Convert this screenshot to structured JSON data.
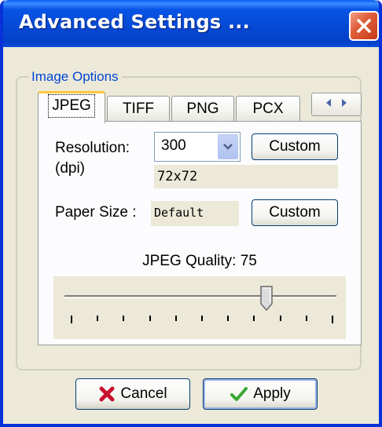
{
  "window": {
    "title": "Advanced Settings ..."
  },
  "group": {
    "legend": "Image Options"
  },
  "tabs": [
    {
      "label": "JPEG",
      "active": true
    },
    {
      "label": "TIFF",
      "active": false
    },
    {
      "label": "PNG",
      "active": false
    },
    {
      "label": "PCX",
      "active": false
    }
  ],
  "scroll": {
    "left_icon": "arrow-left-icon",
    "right_icon": "arrow-right-icon"
  },
  "resolution": {
    "label_line1": "Resolution:",
    "label_line2": "(dpi)",
    "selected": "300",
    "custom_label": "Custom",
    "readout": "72x72"
  },
  "paper": {
    "label": "Paper Size :",
    "value": "Default",
    "custom_label": "Custom"
  },
  "quality": {
    "label": "JPEG Quality:",
    "value": "75",
    "slider_fraction": 0.75,
    "tick_count": 11
  },
  "footer": {
    "cancel_label": "Cancel",
    "cancel_icon": "red-x-icon",
    "apply_label": "Apply",
    "apply_icon": "green-check-icon"
  },
  "colors": {
    "titlebar": "#0854e6",
    "legend": "#0046d5",
    "close": "#e0603a",
    "active_tab_accent": "#ffc83c",
    "cancel_icon": "#c8102e",
    "apply_icon": "#3aa832"
  }
}
